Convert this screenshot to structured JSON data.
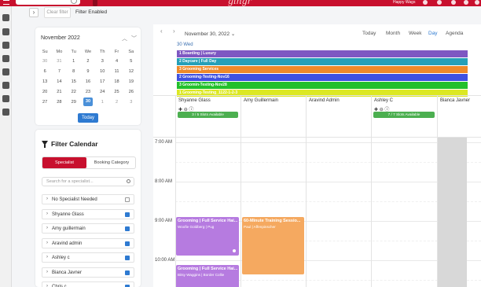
{
  "topbar": {
    "brand": "gingr",
    "business_name": "Happy Wags",
    "search_placeholder": ""
  },
  "filterbar": {
    "clear_label": "Clear filter",
    "status": "Filter Enabled"
  },
  "mini_calendar": {
    "month_label": "November 2022",
    "weekdays": [
      "Su",
      "Mo",
      "Tu",
      "We",
      "Th",
      "Fr",
      "Sa"
    ],
    "weeks": [
      [
        "30",
        "31",
        "1",
        "2",
        "3",
        "4",
        "5"
      ],
      [
        "6",
        "7",
        "8",
        "9",
        "10",
        "11",
        "12"
      ],
      [
        "13",
        "14",
        "15",
        "16",
        "17",
        "18",
        "19"
      ],
      [
        "20",
        "21",
        "22",
        "23",
        "24",
        "25",
        "26"
      ],
      [
        "27",
        "28",
        "29",
        "30",
        "1",
        "2",
        "3"
      ]
    ],
    "selected": "30",
    "today_label": "Today"
  },
  "filter_panel": {
    "title": "Filter Calendar",
    "tab_active": "Specialist",
    "tab_inactive": "Booking Category",
    "search_placeholder": "Search for a specialist...",
    "specialists": [
      {
        "label": "No Specialist Needed",
        "checked": false
      },
      {
        "label": "Shyanne Glass",
        "checked": true
      },
      {
        "label": "Amy guillermain",
        "checked": true
      },
      {
        "label": "Aravind admin",
        "checked": true
      },
      {
        "label": "Ashley c",
        "checked": true
      },
      {
        "label": "Bianca Javner",
        "checked": true
      },
      {
        "label": "Chris c",
        "checked": true
      }
    ]
  },
  "calendar": {
    "date_label": "November 30, 2022",
    "views": [
      "Today",
      "Month",
      "Week",
      "Day",
      "Agenda"
    ],
    "active_view": "Day",
    "allday_header": "30 Wed",
    "allday_bars": [
      {
        "label": "1 Boarding | Luxury",
        "color": "#7e57c2"
      },
      {
        "label": "2 Daycare | Full Day",
        "color": "#26a0b8"
      },
      {
        "label": "3 Grooming Services",
        "color": "#ef8a2a"
      },
      {
        "label": "2 Grooming-Testing-Nov16",
        "color": "#3f51e0"
      },
      {
        "label": "3 Groomin-Testing-Nov28",
        "color": "#22c02b"
      },
      {
        "label": "1 Grooming-Testing_1122-1-2-3",
        "color": "#dce823"
      }
    ],
    "resources": [
      {
        "name": "Shyanne Glass",
        "icons": "✚ ⊖ ⓘ",
        "slots": "3 / 5 Slots Available"
      },
      {
        "name": "Amy Guillermain",
        "icons": "",
        "slots": ""
      },
      {
        "name": "Aravind Admin",
        "icons": "",
        "slots": ""
      },
      {
        "name": "Ashley C",
        "icons": "✚ ⊖ ⓘ",
        "slots": "7 / 7 Slots Available"
      },
      {
        "name": "Bianca Javner",
        "icons": "",
        "slots": ""
      }
    ],
    "time_labels": [
      "7:00 AM",
      "8:00 AM",
      "9:00 AM",
      "10:00 AM"
    ],
    "events": [
      {
        "title": "Grooming | Full Service Hai...",
        "sub": "Woofie Goldberg | Pug",
        "color": "#b67be0"
      },
      {
        "title": "60-Minute Training Sessio...",
        "sub": "Paul | Affenpinscher",
        "color": "#f5a960"
      },
      {
        "title": "Grooming | Full Service Hai...",
        "sub": "Bitsy Waggins | Border Collie",
        "color": "#b67be0"
      }
    ]
  },
  "colors": {
    "brand_red": "#c8102e",
    "accent_blue": "#2e7ad1",
    "slot_green": "#4caf50"
  }
}
